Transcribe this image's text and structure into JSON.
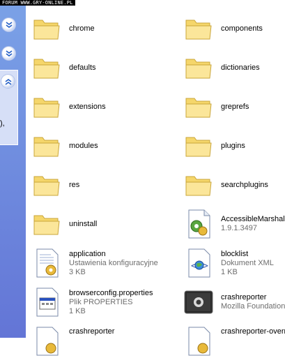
{
  "watermark": "FORUM WWW.GRY-ONLINE.PL",
  "task_pane": {
    "partial_text": "),"
  },
  "folders": [
    {
      "name": "chrome"
    },
    {
      "name": "components"
    },
    {
      "name": "defaults"
    },
    {
      "name": "dictionaries"
    },
    {
      "name": "extensions"
    },
    {
      "name": "greprefs"
    },
    {
      "name": "modules"
    },
    {
      "name": "plugins"
    },
    {
      "name": "res"
    },
    {
      "name": "searchplugins"
    },
    {
      "name": "uninstall"
    }
  ],
  "files": [
    {
      "name": "AccessibleMarshal.dl",
      "line2": "1.9.1.3497",
      "line3": "",
      "icon": "dll-gear-icon"
    },
    {
      "name": "application",
      "line2": "Ustawienia konfiguracyjne",
      "line3": "3 KB",
      "icon": "config-settings-icon"
    },
    {
      "name": "blocklist",
      "line2": "Dokument XML",
      "line3": "1 KB",
      "icon": "xml-document-icon"
    },
    {
      "name": "browserconfig.properties",
      "line2": "Plik PROPERTIES",
      "line3": "1 KB",
      "icon": "properties-file-icon"
    },
    {
      "name": "crashreporter",
      "line2": "Mozilla Foundation",
      "line3": "",
      "icon": "crashreporter-app-icon"
    },
    {
      "name": "crashreporter",
      "line2": "",
      "line3": "",
      "icon": "config-settings-icon"
    },
    {
      "name": "crashreporter-overri",
      "line2": "",
      "line3": "",
      "icon": "config-settings-icon"
    }
  ],
  "colors": {
    "task_pane_top": "#7ba2e7",
    "task_pane_bottom": "#6375d6",
    "folder_fill": "#f7de7b",
    "folder_shade": "#e8c34a",
    "detail_text": "#6d6d6d"
  }
}
